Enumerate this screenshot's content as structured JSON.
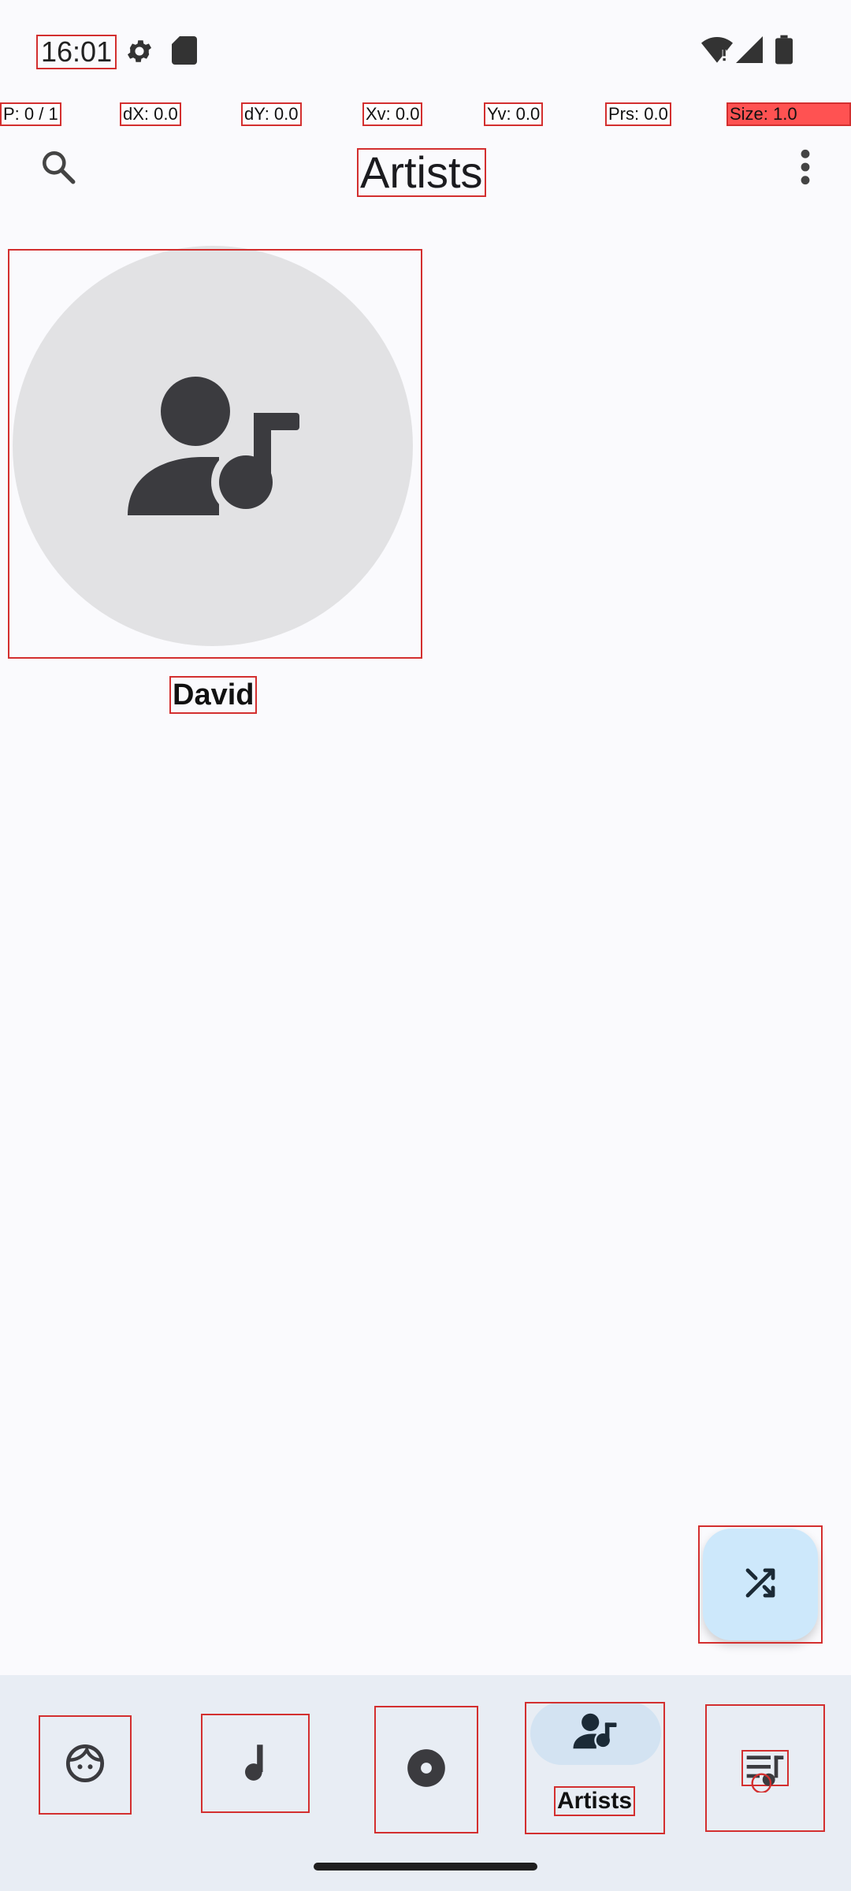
{
  "status_bar": {
    "time": "16:01",
    "icons": [
      "settings-gear-icon",
      "sd-card-icon",
      "wifi-icon",
      "cellular-signal-icon",
      "battery-icon"
    ]
  },
  "pointer_overlay": {
    "p": "P: 0 / 1",
    "dx": "dX: 0.0",
    "dy": "dY: 0.0",
    "xv": "Xv: 0.0",
    "yv": "Yv: 0.0",
    "prs": "Prs: 0.0",
    "size": "Size: 1.0"
  },
  "app_bar": {
    "title": "Artists",
    "icons": [
      "search-icon",
      "more-vert-icon"
    ]
  },
  "artists": [
    {
      "name": "David",
      "icon": "artist-placeholder-icon"
    }
  ],
  "fab": {
    "icon": "shuffle-icon"
  },
  "bottom_nav": {
    "items": [
      {
        "id": "for-you",
        "icon": "face-icon",
        "label": ""
      },
      {
        "id": "songs",
        "icon": "music-note-icon",
        "label": ""
      },
      {
        "id": "albums",
        "icon": "album-icon",
        "label": ""
      },
      {
        "id": "artists",
        "icon": "artist-icon",
        "label": "Artists",
        "selected": true
      },
      {
        "id": "playlists",
        "icon": "playlist-icon",
        "label": ""
      }
    ]
  },
  "colors": {
    "background": "#FAFAFD",
    "nav_background": "#E8EDF4",
    "selected_pill": "#D3E3F2",
    "fab": "#CDE8FB",
    "avatar": "#E2E2E4",
    "icon": "#3B3B3F",
    "highlight_outline": "#D32F2F"
  }
}
